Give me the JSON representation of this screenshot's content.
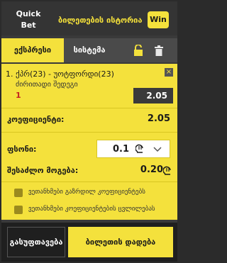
{
  "header": {
    "quick_bet_line1": "Quick",
    "quick_bet_line2": "Bet",
    "history_link": "ბილეთების ისტორია",
    "win_badge": "Win"
  },
  "tabs": {
    "express": "ექსპრესი",
    "system": "სისტემა",
    "icons": [
      "lock-open-icon",
      "trash-icon"
    ]
  },
  "bet": {
    "title": "1. ქპრ(23) - უოტფორდი(23)",
    "market": "ძირითადი შედეგი",
    "pick": "1",
    "odd": "2.05",
    "close": "×"
  },
  "summary": {
    "coefficient_label": "კოეფიციენტი:",
    "coefficient_value": "2.05",
    "stake_label": "ფსონი:",
    "stake_value": "0.1",
    "possible_win_label": "შესაძლო მოგება:",
    "possible_win_value": "0.20"
  },
  "options": {
    "accept_higher": "ვეთანხმები გაზრდილ კოეფიციენტებს",
    "accept_changes": "ვეთანხმები კოეფიციენტების ცვლილებას"
  },
  "footer": {
    "clear_label": "გასუფთავება",
    "place_label": "ბილეთის დადება"
  },
  "colors": {
    "accent": "#f4e13c",
    "dark": "#3a3a3a",
    "pick_red": "#c5221f"
  }
}
